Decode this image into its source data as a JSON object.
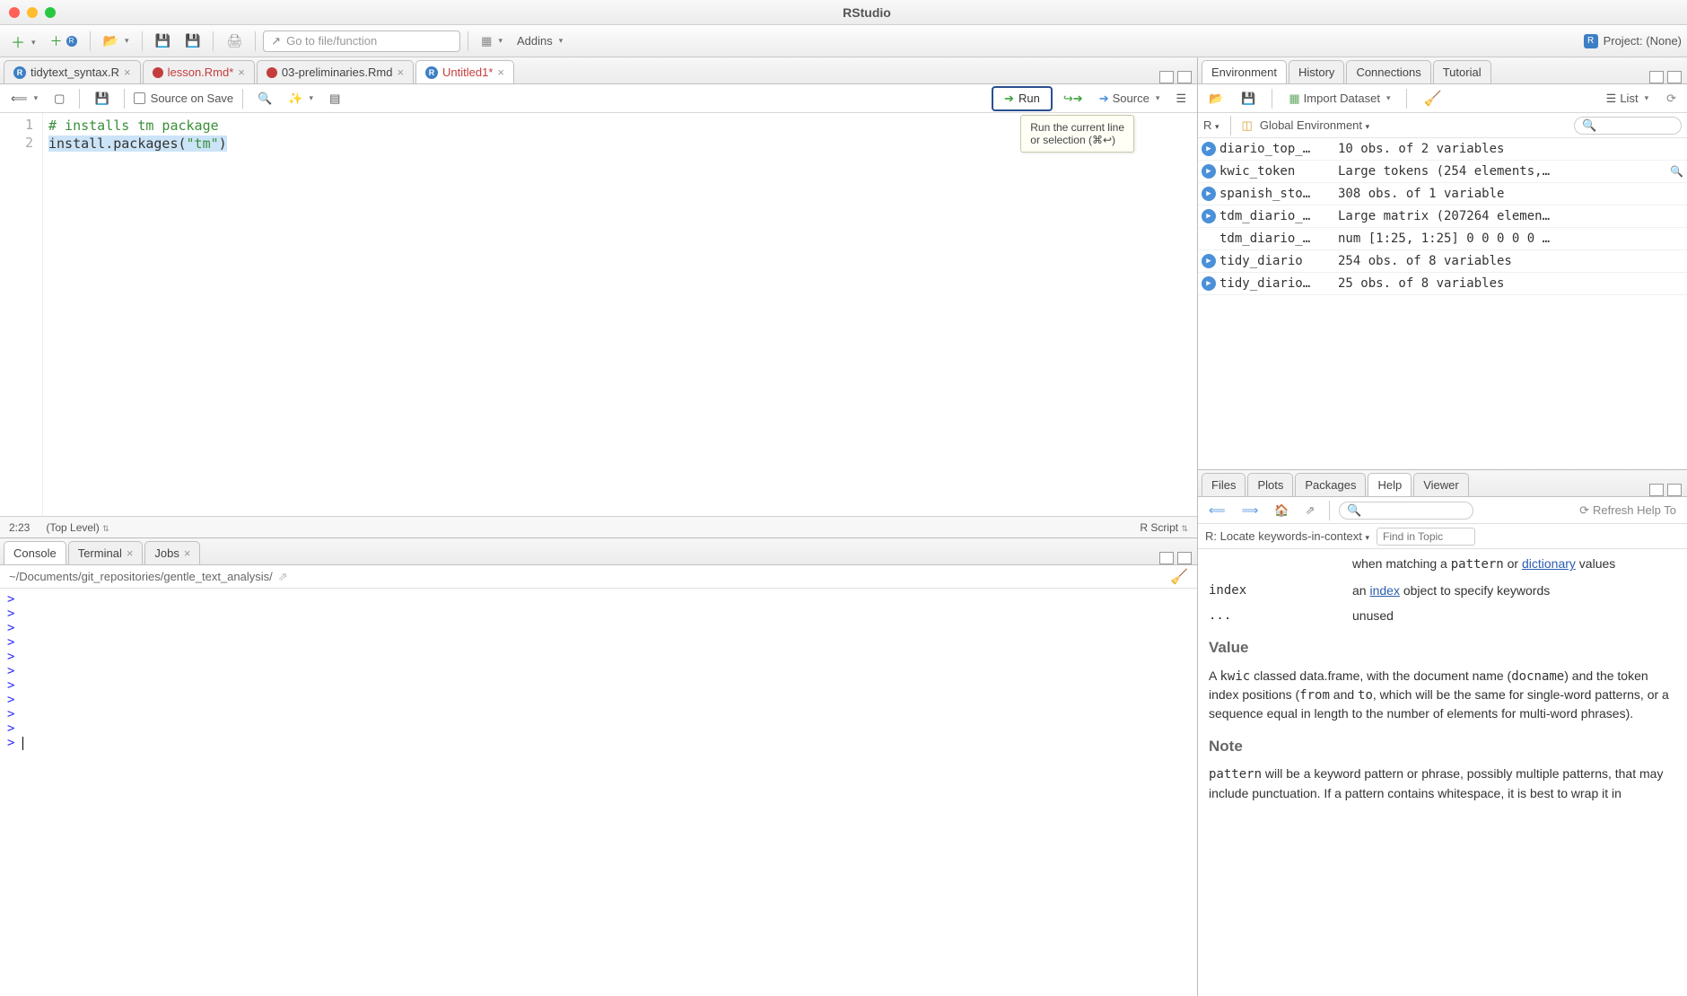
{
  "app": {
    "title": "RStudio"
  },
  "project": {
    "label": "Project: (None)"
  },
  "maintoolbar": {
    "goto_placeholder": "Go to file/function",
    "addins_label": "Addins"
  },
  "source": {
    "tabs": [
      {
        "label": "tidytext_syntax.R",
        "icon": "r",
        "active": false,
        "dirty": false
      },
      {
        "label": "lesson.Rmd*",
        "icon": "rmd",
        "active": false,
        "dirty": true,
        "color": "#c43d3d"
      },
      {
        "label": "03-preliminaries.Rmd",
        "icon": "rmd",
        "active": false,
        "dirty": false
      },
      {
        "label": "Untitled1*",
        "icon": "r",
        "active": true,
        "dirty": true,
        "color": "#c43d3d"
      }
    ],
    "toolbar": {
      "source_on_save": "Source on Save",
      "run": "Run",
      "source": "Source",
      "tooltip": "Run the current line\nor selection (⌘↩)"
    },
    "code": {
      "lines": [
        {
          "n": "1",
          "segments": [
            {
              "cls": "comment",
              "t": "# installs tm package"
            }
          ]
        },
        {
          "n": "2",
          "segments": [
            {
              "cls": "funcname sel",
              "t": "install.packages("
            },
            {
              "cls": "string sel",
              "t": "\"tm\""
            },
            {
              "cls": "funcname sel",
              "t": ")"
            }
          ]
        }
      ]
    },
    "status": {
      "pos": "2:23",
      "scope": "(Top Level)",
      "type": "R Script"
    }
  },
  "console": {
    "tabs": [
      {
        "label": "Console",
        "active": true
      },
      {
        "label": "Terminal",
        "active": false
      },
      {
        "label": "Jobs",
        "active": false
      }
    ],
    "path": "~/Documents/git_repositories/gentle_text_analysis/",
    "prompts": 11
  },
  "environment": {
    "tabs": [
      {
        "label": "Environment",
        "active": true
      },
      {
        "label": "History",
        "active": false
      },
      {
        "label": "Connections",
        "active": false
      },
      {
        "label": "Tutorial",
        "active": false
      }
    ],
    "toolbar": {
      "import": "Import Dataset",
      "list": "List"
    },
    "scope": {
      "lang": "R",
      "env": "Global Environment"
    },
    "rows": [
      {
        "name": "diario_top_…",
        "val": "10 obs. of 2 variables",
        "expand": true
      },
      {
        "name": "kwic_token",
        "val": "Large tokens (254 elements,…",
        "expand": true,
        "mag": true
      },
      {
        "name": "spanish_sto…",
        "val": "308 obs. of 1 variable",
        "expand": true
      },
      {
        "name": "tdm_diario_…",
        "val": "Large matrix (207264 elemen…",
        "expand": true
      },
      {
        "name": "tdm_diario_…",
        "val": "num [1:25, 1:25] 0 0 0 0 0 …",
        "expand": false
      },
      {
        "name": "tidy_diario",
        "val": "254 obs. of 8 variables",
        "expand": true
      },
      {
        "name": "tidy_diario…",
        "val": "25 obs. of 8 variables",
        "expand": true
      }
    ]
  },
  "help": {
    "tabs": [
      {
        "label": "Files",
        "active": false
      },
      {
        "label": "Plots",
        "active": false
      },
      {
        "label": "Packages",
        "active": false
      },
      {
        "label": "Help",
        "active": true
      },
      {
        "label": "Viewer",
        "active": false
      }
    ],
    "toolbar": {
      "refresh": "Refresh Help To"
    },
    "topic": {
      "breadcrumb": "R: Locate keywords-in-context",
      "find_placeholder": "Find in Topic"
    },
    "content": {
      "frag_top1": "when matching a ",
      "frag_top_code": "pattern",
      "frag_top2": " or ",
      "frag_top_link": "dictionary",
      "frag_top3": " values",
      "param_index_name": "index",
      "param_index_desc1": "an ",
      "param_index_link": "index",
      "param_index_desc2": " object to specify keywords",
      "param_dots": "...",
      "param_dots_desc": "unused",
      "h_value": "Value",
      "value_text1": "A ",
      "value_code1": "kwic",
      "value_text2": " classed data.frame, with the document name (",
      "value_code2": "docname",
      "value_text3": ") and the token index positions (",
      "value_code3": "from",
      "value_text4": " and ",
      "value_code4": "to",
      "value_text5": ", which will be the same for single-word patterns, or a sequence equal in length to the number of elements for multi-word phrases).",
      "h_note": "Note",
      "note_code": "pattern",
      "note_text": " will be a keyword pattern or phrase, possibly multiple patterns, that may include punctuation. If a pattern contains whitespace, it is best to wrap it in"
    }
  }
}
